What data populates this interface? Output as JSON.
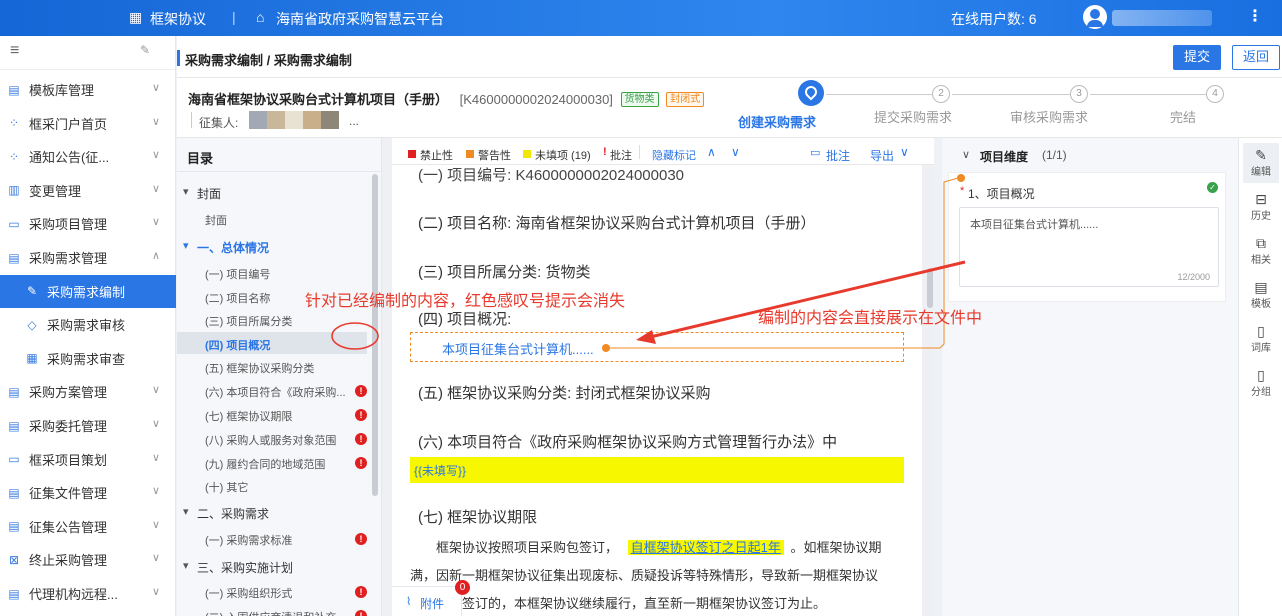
{
  "topbar": {
    "menu_label": "框架协议",
    "platform": "海南省政府采购智慧云平台",
    "online_users_label": "在线用户数: 6"
  },
  "sidebar": {
    "items": [
      {
        "label": "模板库管理",
        "icon": "template-icon"
      },
      {
        "label": "框采门户首页",
        "icon": "grid-icon"
      },
      {
        "label": "通知公告(征...",
        "icon": "grid-icon"
      },
      {
        "label": "变更管理",
        "icon": "change-icon"
      },
      {
        "label": "采购项目管理",
        "icon": "folder-icon"
      },
      {
        "label": "采购需求管理",
        "icon": "document-icon",
        "expanded": true
      },
      {
        "label": "采购需求编制",
        "icon": "edit-icon",
        "active": true,
        "child": true
      },
      {
        "label": "采购需求审核",
        "icon": "diamond-icon",
        "child": true
      },
      {
        "label": "采购需求审查",
        "icon": "search-doc-icon",
        "child": true
      },
      {
        "label": "采购方案管理",
        "icon": "document-icon"
      },
      {
        "label": "采购委托管理",
        "icon": "document-icon"
      },
      {
        "label": "框采项目策划",
        "icon": "folder-icon"
      },
      {
        "label": "征集文件管理",
        "icon": "document-icon"
      },
      {
        "label": "征集公告管理",
        "icon": "document-icon"
      },
      {
        "label": "终止采购管理",
        "icon": "stop-icon"
      },
      {
        "label": "代理机构远程...",
        "icon": "document-icon"
      }
    ]
  },
  "header": {
    "breadcrumb": "采购需求编制 / 采购需求编制",
    "submit_label": "提交",
    "back_label": "返回"
  },
  "project": {
    "title": "海南省框架协议采购台式计算机项目（手册）",
    "code": "[K4600000002024000030]",
    "tag_goods": "货物类",
    "tag_closed": "封闭式",
    "collector_label": "征集人:",
    "collector_suffix": "..."
  },
  "steps": [
    {
      "num": "1",
      "label": "创建采购需求",
      "active": true
    },
    {
      "num": "2",
      "label": "提交采购需求"
    },
    {
      "num": "3",
      "label": "审核采购需求"
    },
    {
      "num": "4",
      "label": "完结"
    }
  ],
  "toc": {
    "title": "目录",
    "items": [
      {
        "label": "封面",
        "level": 0,
        "arrow": "▾"
      },
      {
        "label": "封面",
        "level": 1
      },
      {
        "label": "一、总体情况",
        "level": 0,
        "arrow": "▾",
        "highlight": true
      },
      {
        "label": "(一) 项目编号",
        "level": 1
      },
      {
        "label": "(二) 项目名称",
        "level": 1
      },
      {
        "label": "(三) 项目所属分类",
        "level": 1
      },
      {
        "label": "(四) 项目概况",
        "level": 1,
        "selected": true
      },
      {
        "label": "(五) 框架协议采购分类",
        "level": 1
      },
      {
        "label": "(六) 本项目符合《政府采购...",
        "level": 1,
        "warn": true
      },
      {
        "label": "(七) 框架协议期限",
        "level": 1,
        "warn": true
      },
      {
        "label": "(八) 采购人或服务对象范围",
        "level": 1,
        "warn": true
      },
      {
        "label": "(九) 履约合同的地域范围",
        "level": 1,
        "warn": true
      },
      {
        "label": "(十) 其它",
        "level": 1
      },
      {
        "label": "二、采购需求",
        "level": 0,
        "arrow": "▾"
      },
      {
        "label": "(一) 采购需求标准",
        "level": 1,
        "warn": true
      },
      {
        "label": "三、采购实施计划",
        "level": 0,
        "arrow": "▾"
      },
      {
        "label": "(一) 采购组织形式",
        "level": 1,
        "warn": true
      },
      {
        "label": "(二) 入围供应商清退和补充...",
        "level": 1,
        "warn": true
      }
    ]
  },
  "doc_toolbar": {
    "prohibit": "禁止性",
    "warning": "警告性",
    "unfilled": "未填项 (19)",
    "comment_mark": "批注",
    "hide_mark": "隐藏标记",
    "comment_btn": "批注",
    "export_btn": "导出",
    "colors": {
      "prohibit": "#e02020",
      "warning": "#f08a24",
      "unfilled": "#f5e600",
      "comment": "#e02020"
    }
  },
  "document": {
    "l1": "(一) 项目编号:  K4600000002024000030",
    "l2": "(二) 项目名称:  海南省框架协议采购台式计算机项目（手册）",
    "l3": "(三) 项目所属分类:  货物类",
    "l4": "(四) 项目概况:",
    "l4_content": "本项目征集台式计算机......",
    "l5": "(五) 框架协议采购分类:  封闭式框架协议采购",
    "l6": "(六) 本项目符合《政府采购框架协议采购方式管理暂行办法》中",
    "l6_unfilled": "{{未填写}}",
    "l7": "(七) 框架协议期限",
    "p1a": "框架协议按照项目采购包签订，",
    "p1_link": "自框架协议签订之日起1年",
    "p1b": "。如框架协议期",
    "p2": "满，因新一期框架协议征集出现废标、质疑投诉等特殊情形，导致新一期框架协议",
    "p3": "签订的，本框架协议继续履行，直至新一期框架协议签订为止。"
  },
  "attachment": {
    "label": "附件",
    "count": "0"
  },
  "right_panel": {
    "header": "项目维度",
    "count": "(1/1)",
    "field_label": "1、项目概况",
    "required_mark": "*",
    "field_value": "本项目征集台式计算机......",
    "char_count": "12/2000"
  },
  "right_tools": [
    {
      "label": "编辑",
      "icon": "edit-icon"
    },
    {
      "label": "历史",
      "icon": "history-icon"
    },
    {
      "label": "相关",
      "icon": "related-icon"
    },
    {
      "label": "模板",
      "icon": "template-icon"
    },
    {
      "label": "词库",
      "icon": "book-icon"
    },
    {
      "label": "分组",
      "icon": "group-icon"
    }
  ],
  "annotations": {
    "left_note": "针对已经编制的内容，红色感叹号提示会消失",
    "right_note": "编制的内容会直接展示在文件中",
    "color": "#e83a2c"
  }
}
